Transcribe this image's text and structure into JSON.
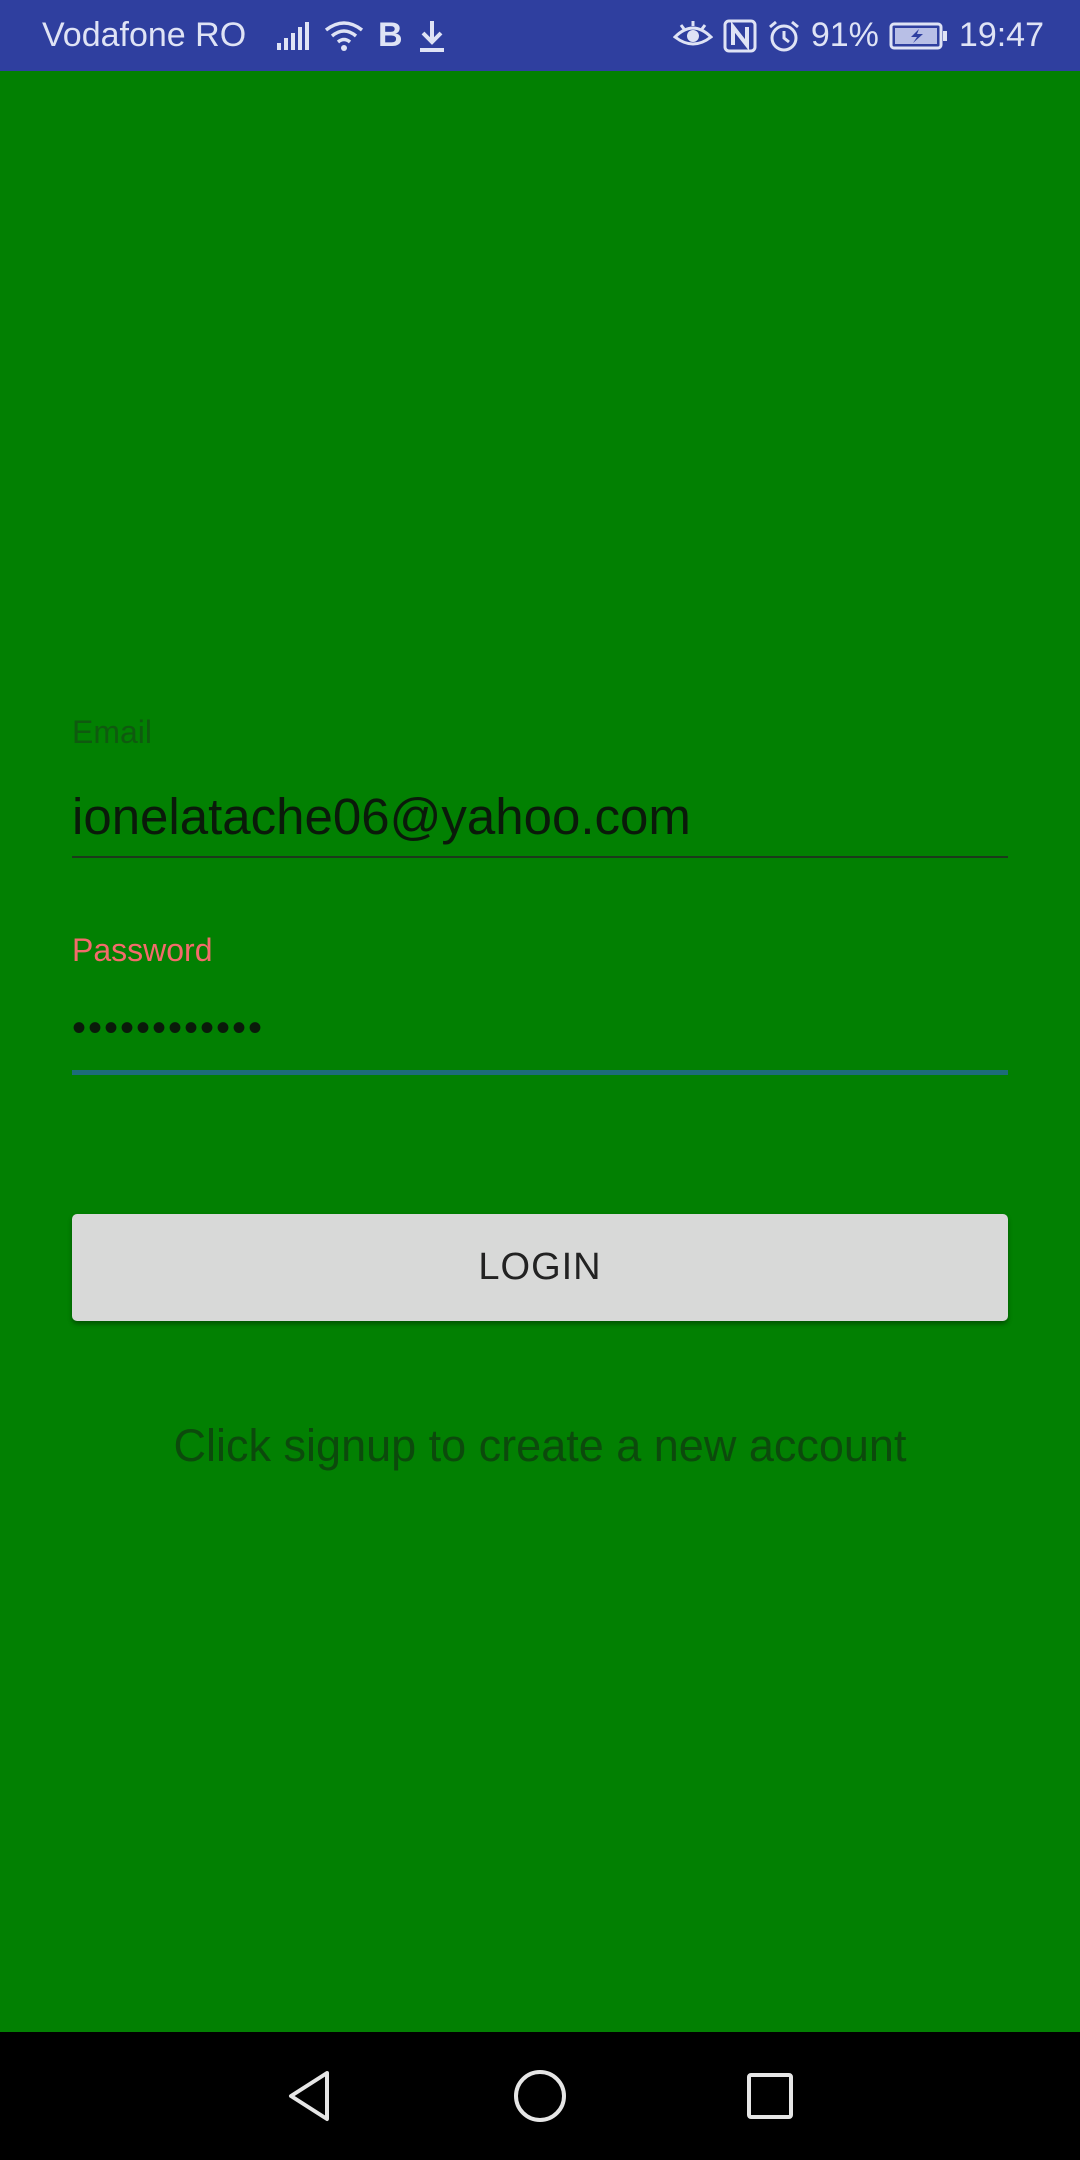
{
  "status_bar": {
    "carrier": "Vodafone RO",
    "bluetooth_label": "B",
    "battery_percent": "91%",
    "time": "19:47",
    "icons": [
      "signal-icon",
      "wifi-icon",
      "bluetooth-icon",
      "download-icon",
      "eye-icon",
      "nfc-icon",
      "alarm-icon",
      "battery-charging-icon"
    ]
  },
  "login_form": {
    "email": {
      "label": "Email",
      "value": "ionelatache06@yahoo.com"
    },
    "password": {
      "label": "Password",
      "value": "••••••••••••"
    },
    "login_button_label": "LOGIN",
    "signup_text": "Click signup to create a new account"
  },
  "colors": {
    "background": "#028002",
    "status_bar": "#2f3f9f",
    "password_label_error": "#f46b6b",
    "focused_underline": "#1d6c7a",
    "button_background": "#d8d9d8"
  },
  "nav_bar": {
    "buttons": [
      "back-icon",
      "home-icon",
      "recents-icon"
    ]
  }
}
